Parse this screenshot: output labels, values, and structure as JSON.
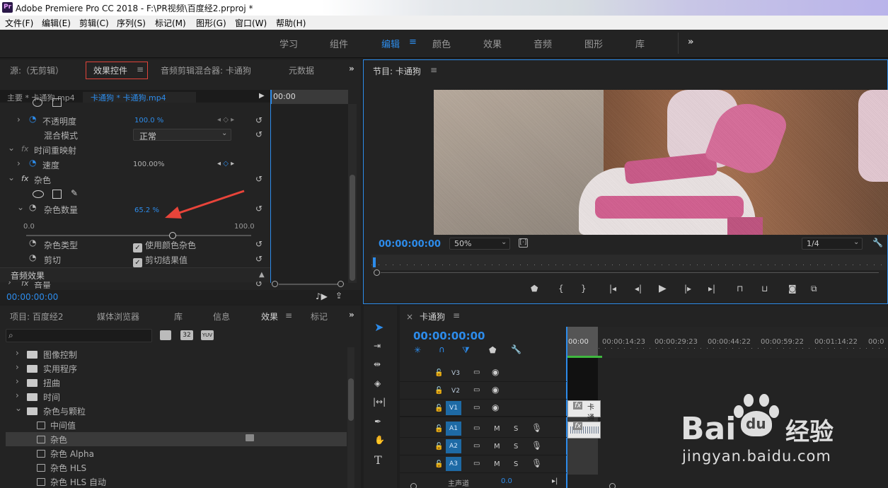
{
  "titlebar": {
    "app_title": "Adobe Premiere Pro CC 2018 - F:\\PR视频\\百度经2.prproj *",
    "logo": "Pr"
  },
  "menubar": [
    "文件(F)",
    "编辑(E)",
    "剪辑(C)",
    "序列(S)",
    "标记(M)",
    "图形(G)",
    "窗口(W)",
    "帮助(H)"
  ],
  "workspaces": {
    "items": [
      "学习",
      "组件",
      "编辑",
      "颜色",
      "效果",
      "音频",
      "图形",
      "库"
    ],
    "active": "编辑",
    "more": "»"
  },
  "source_panel": {
    "tabs": {
      "source": "源:（无剪辑）",
      "effect_controls": "效果控件",
      "audio_mixer": "音频剪辑混合器: 卡通狗",
      "metadata": "元数据"
    },
    "master_clip": "主要 * 卡通狗.mp4",
    "seq_clip": "卡通狗 * 卡通狗.mp4",
    "timecode_head": "00:00",
    "opacity": {
      "label": "不透明度",
      "value": "100.0 %"
    },
    "blend": {
      "label": "混合模式",
      "value": "正常"
    },
    "time_remap": {
      "label": "时间重映射"
    },
    "speed": {
      "label": "速度",
      "value": "100.00%"
    },
    "noise": {
      "label": "杂色"
    },
    "noise_amount": {
      "label": "杂色数量",
      "value": "65.2 %",
      "min": "0.0",
      "max": "100.0",
      "level": 0.652
    },
    "noise_type": {
      "label": "杂色类型",
      "option": "使用颜色杂色"
    },
    "clipping": {
      "label": "剪切",
      "option": "剪切结果值"
    },
    "audio_effects": "音频效果",
    "volume": "音量",
    "current_time": "00:00:00:00"
  },
  "program_monitor": {
    "title": "节目: 卡通狗",
    "timecode": "00:00:00:00",
    "zoom": "50%",
    "resolution": "1/4"
  },
  "project_panel": {
    "tabs": {
      "project": "项目: 百度经2",
      "media": "媒体浏览器",
      "library": "库",
      "info": "信息",
      "effects": "效果",
      "markers": "标记"
    },
    "search_placeholder": "",
    "icons": {
      "accel": "32",
      "yuv": "YUV"
    },
    "folders": [
      "图像控制",
      "实用程序",
      "扭曲",
      "时间",
      "杂色与颗粒"
    ],
    "effects": [
      "中间值",
      "杂色",
      "杂色 Alpha",
      "杂色 HLS",
      "杂色 HLS 自动"
    ],
    "selected_effect": "杂色"
  },
  "timeline": {
    "close": "×",
    "title": "卡通狗",
    "timecode": "00:00:00:00",
    "ruler": [
      "00:00",
      "00:00:14:23",
      "00:00:29:23",
      "00:00:44:22",
      "00:00:59:22",
      "00:01:14:22",
      "00:0"
    ],
    "video_tracks": [
      "V3",
      "V2",
      "V1"
    ],
    "audio_tracks": [
      "A1",
      "A2",
      "A3"
    ],
    "mute": "M",
    "solo": "S",
    "master": "主声道",
    "master_value": "0.0",
    "clip_fx": "fx",
    "clip_label": "卡通"
  },
  "watermark": {
    "brand": "Bai",
    "brand2": "du",
    "sub": "经验",
    "url": "jingyan.baidu.com"
  },
  "colors": {
    "accent": "#2d8ceb",
    "highlight_border": "#e0443a",
    "arrow": "#e8443a",
    "panel_bg": "#232323",
    "track_blue": "#1e6aa5"
  }
}
